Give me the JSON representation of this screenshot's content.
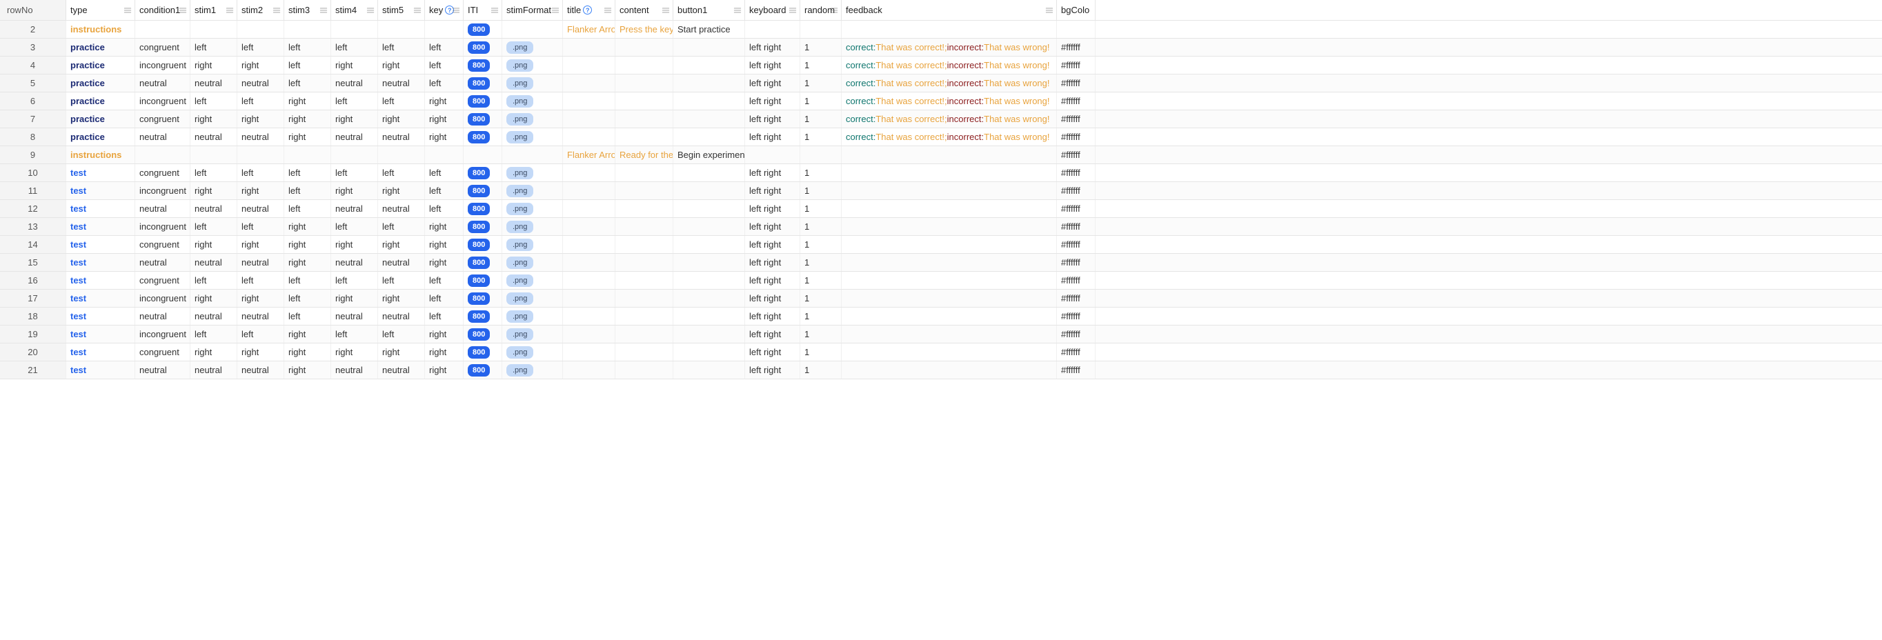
{
  "columns": [
    {
      "key": "rowNo",
      "label": "rowNo",
      "cls": "w-rowno",
      "menu": false,
      "help": false
    },
    {
      "key": "type",
      "label": "type",
      "cls": "w-type",
      "menu": true,
      "help": false,
      "isType": true
    },
    {
      "key": "condition1",
      "label": "condition1",
      "cls": "w-cond",
      "menu": true,
      "help": false
    },
    {
      "key": "stim1",
      "label": "stim1",
      "cls": "w-stim",
      "menu": true,
      "help": false
    },
    {
      "key": "stim2",
      "label": "stim2",
      "cls": "w-stim",
      "menu": true,
      "help": false
    },
    {
      "key": "stim3",
      "label": "stim3",
      "cls": "w-stim",
      "menu": true,
      "help": false
    },
    {
      "key": "stim4",
      "label": "stim4",
      "cls": "w-stim",
      "menu": true,
      "help": false
    },
    {
      "key": "stim5",
      "label": "stim5",
      "cls": "w-stim",
      "menu": true,
      "help": false
    },
    {
      "key": "key",
      "label": "key",
      "cls": "w-key",
      "menu": true,
      "help": true
    },
    {
      "key": "ITI",
      "label": "ITI",
      "cls": "w-iti",
      "menu": true,
      "help": false,
      "chip": "blue"
    },
    {
      "key": "stimFormat",
      "label": "stimFormat",
      "cls": "w-fmt",
      "menu": true,
      "help": false,
      "chip": "light"
    },
    {
      "key": "title",
      "label": "title",
      "cls": "w-title",
      "menu": true,
      "help": true
    },
    {
      "key": "content",
      "label": "content",
      "cls": "w-content",
      "menu": true,
      "help": false
    },
    {
      "key": "button1",
      "label": "button1",
      "cls": "w-btn",
      "menu": true,
      "help": false
    },
    {
      "key": "keyboard",
      "label": "keyboard",
      "cls": "w-kbd",
      "menu": true,
      "help": false
    },
    {
      "key": "random",
      "label": "random",
      "cls": "w-rand",
      "menu": true,
      "help": false
    },
    {
      "key": "feedback",
      "label": "feedback",
      "cls": "w-fb",
      "menu": true,
      "help": false
    },
    {
      "key": "bgColo",
      "label": "bgColo",
      "cls": "w-bg",
      "menu": false,
      "help": false
    }
  ],
  "typeClasses": {
    "instructions": "type-instructions",
    "practice": "type-practice",
    "test": "type-test"
  },
  "feedbackParts": {
    "cLabel": "correct:",
    "cMsg": " That was correct!; ",
    "iLabel": "incorrect:",
    "iMsg": " That was wrong!"
  },
  "rows": [
    {
      "rowNo": "2",
      "type": "instructions",
      "condition1": "",
      "stim1": "",
      "stim2": "",
      "stim3": "",
      "stim4": "",
      "stim5": "",
      "key": "",
      "ITI": "800",
      "stimFormat": "",
      "title": "Flanker Arro",
      "content": "Press the key",
      "button1": "Start practice",
      "keyboard": "",
      "random": "",
      "feedback": "",
      "bgColo": ""
    },
    {
      "rowNo": "3",
      "type": "practice",
      "condition1": "congruent",
      "stim1": "left",
      "stim2": "left",
      "stim3": "left",
      "stim4": "left",
      "stim5": "left",
      "key": "left",
      "ITI": "800",
      "stimFormat": ".png",
      "title": "",
      "content": "",
      "button1": "",
      "keyboard": "left right",
      "random": "1",
      "feedback": "FB",
      "bgColo": "#ffffff"
    },
    {
      "rowNo": "4",
      "type": "practice",
      "condition1": "incongruent",
      "stim1": "right",
      "stim2": "right",
      "stim3": "left",
      "stim4": "right",
      "stim5": "right",
      "key": "left",
      "ITI": "800",
      "stimFormat": ".png",
      "title": "",
      "content": "",
      "button1": "",
      "keyboard": "left right",
      "random": "1",
      "feedback": "FB",
      "bgColo": "#ffffff"
    },
    {
      "rowNo": "5",
      "type": "practice",
      "condition1": "neutral",
      "stim1": "neutral",
      "stim2": "neutral",
      "stim3": "left",
      "stim4": "neutral",
      "stim5": "neutral",
      "key": "left",
      "ITI": "800",
      "stimFormat": ".png",
      "title": "",
      "content": "",
      "button1": "",
      "keyboard": "left right",
      "random": "1",
      "feedback": "FB",
      "bgColo": "#ffffff"
    },
    {
      "rowNo": "6",
      "type": "practice",
      "condition1": "incongruent",
      "stim1": "left",
      "stim2": "left",
      "stim3": "right",
      "stim4": "left",
      "stim5": "left",
      "key": "right",
      "ITI": "800",
      "stimFormat": ".png",
      "title": "",
      "content": "",
      "button1": "",
      "keyboard": "left right",
      "random": "1",
      "feedback": "FB",
      "bgColo": "#ffffff"
    },
    {
      "rowNo": "7",
      "type": "practice",
      "condition1": "congruent",
      "stim1": "right",
      "stim2": "right",
      "stim3": "right",
      "stim4": "right",
      "stim5": "right",
      "key": "right",
      "ITI": "800",
      "stimFormat": ".png",
      "title": "",
      "content": "",
      "button1": "",
      "keyboard": "left right",
      "random": "1",
      "feedback": "FB",
      "bgColo": "#ffffff"
    },
    {
      "rowNo": "8",
      "type": "practice",
      "condition1": "neutral",
      "stim1": "neutral",
      "stim2": "neutral",
      "stim3": "right",
      "stim4": "neutral",
      "stim5": "neutral",
      "key": "right",
      "ITI": "800",
      "stimFormat": ".png",
      "title": "",
      "content": "",
      "button1": "",
      "keyboard": "left right",
      "random": "1",
      "feedback": "FB",
      "bgColo": "#ffffff"
    },
    {
      "rowNo": "9",
      "type": "instructions",
      "condition1": "",
      "stim1": "",
      "stim2": "",
      "stim3": "",
      "stim4": "",
      "stim5": "",
      "key": "",
      "ITI": "",
      "stimFormat": "",
      "title": "Flanker Arro",
      "content": "Ready for the",
      "button1": "Begin experiment",
      "keyboard": "",
      "random": "",
      "feedback": "",
      "bgColo": "#ffffff"
    },
    {
      "rowNo": "10",
      "type": "test",
      "condition1": "congruent",
      "stim1": "left",
      "stim2": "left",
      "stim3": "left",
      "stim4": "left",
      "stim5": "left",
      "key": "left",
      "ITI": "800",
      "stimFormat": ".png",
      "title": "",
      "content": "",
      "button1": "",
      "keyboard": "left right",
      "random": "1",
      "feedback": "",
      "bgColo": "#ffffff"
    },
    {
      "rowNo": "11",
      "type": "test",
      "condition1": "incongruent",
      "stim1": "right",
      "stim2": "right",
      "stim3": "left",
      "stim4": "right",
      "stim5": "right",
      "key": "left",
      "ITI": "800",
      "stimFormat": ".png",
      "title": "",
      "content": "",
      "button1": "",
      "keyboard": "left right",
      "random": "1",
      "feedback": "",
      "bgColo": "#ffffff"
    },
    {
      "rowNo": "12",
      "type": "test",
      "condition1": "neutral",
      "stim1": "neutral",
      "stim2": "neutral",
      "stim3": "left",
      "stim4": "neutral",
      "stim5": "neutral",
      "key": "left",
      "ITI": "800",
      "stimFormat": ".png",
      "title": "",
      "content": "",
      "button1": "",
      "keyboard": "left right",
      "random": "1",
      "feedback": "",
      "bgColo": "#ffffff"
    },
    {
      "rowNo": "13",
      "type": "test",
      "condition1": "incongruent",
      "stim1": "left",
      "stim2": "left",
      "stim3": "right",
      "stim4": "left",
      "stim5": "left",
      "key": "right",
      "ITI": "800",
      "stimFormat": ".png",
      "title": "",
      "content": "",
      "button1": "",
      "keyboard": "left right",
      "random": "1",
      "feedback": "",
      "bgColo": "#ffffff"
    },
    {
      "rowNo": "14",
      "type": "test",
      "condition1": "congruent",
      "stim1": "right",
      "stim2": "right",
      "stim3": "right",
      "stim4": "right",
      "stim5": "right",
      "key": "right",
      "ITI": "800",
      "stimFormat": ".png",
      "title": "",
      "content": "",
      "button1": "",
      "keyboard": "left right",
      "random": "1",
      "feedback": "",
      "bgColo": "#ffffff"
    },
    {
      "rowNo": "15",
      "type": "test",
      "condition1": "neutral",
      "stim1": "neutral",
      "stim2": "neutral",
      "stim3": "right",
      "stim4": "neutral",
      "stim5": "neutral",
      "key": "right",
      "ITI": "800",
      "stimFormat": ".png",
      "title": "",
      "content": "",
      "button1": "",
      "keyboard": "left right",
      "random": "1",
      "feedback": "",
      "bgColo": "#ffffff"
    },
    {
      "rowNo": "16",
      "type": "test",
      "condition1": "congruent",
      "stim1": "left",
      "stim2": "left",
      "stim3": "left",
      "stim4": "left",
      "stim5": "left",
      "key": "left",
      "ITI": "800",
      "stimFormat": ".png",
      "title": "",
      "content": "",
      "button1": "",
      "keyboard": "left right",
      "random": "1",
      "feedback": "",
      "bgColo": "#ffffff"
    },
    {
      "rowNo": "17",
      "type": "test",
      "condition1": "incongruent",
      "stim1": "right",
      "stim2": "right",
      "stim3": "left",
      "stim4": "right",
      "stim5": "right",
      "key": "left",
      "ITI": "800",
      "stimFormat": ".png",
      "title": "",
      "content": "",
      "button1": "",
      "keyboard": "left right",
      "random": "1",
      "feedback": "",
      "bgColo": "#ffffff"
    },
    {
      "rowNo": "18",
      "type": "test",
      "condition1": "neutral",
      "stim1": "neutral",
      "stim2": "neutral",
      "stim3": "left",
      "stim4": "neutral",
      "stim5": "neutral",
      "key": "left",
      "ITI": "800",
      "stimFormat": ".png",
      "title": "",
      "content": "",
      "button1": "",
      "keyboard": "left right",
      "random": "1",
      "feedback": "",
      "bgColo": "#ffffff"
    },
    {
      "rowNo": "19",
      "type": "test",
      "condition1": "incongruent",
      "stim1": "left",
      "stim2": "left",
      "stim3": "right",
      "stim4": "left",
      "stim5": "left",
      "key": "right",
      "ITI": "800",
      "stimFormat": ".png",
      "title": "",
      "content": "",
      "button1": "",
      "keyboard": "left right",
      "random": "1",
      "feedback": "",
      "bgColo": "#ffffff"
    },
    {
      "rowNo": "20",
      "type": "test",
      "condition1": "congruent",
      "stim1": "right",
      "stim2": "right",
      "stim3": "right",
      "stim4": "right",
      "stim5": "right",
      "key": "right",
      "ITI": "800",
      "stimFormat": ".png",
      "title": "",
      "content": "",
      "button1": "",
      "keyboard": "left right",
      "random": "1",
      "feedback": "",
      "bgColo": "#ffffff"
    },
    {
      "rowNo": "21",
      "type": "test",
      "condition1": "neutral",
      "stim1": "neutral",
      "stim2": "neutral",
      "stim3": "right",
      "stim4": "neutral",
      "stim5": "neutral",
      "key": "right",
      "ITI": "800",
      "stimFormat": ".png",
      "title": "",
      "content": "",
      "button1": "",
      "keyboard": "left right",
      "random": "1",
      "feedback": "",
      "bgColo": "#ffffff"
    }
  ]
}
